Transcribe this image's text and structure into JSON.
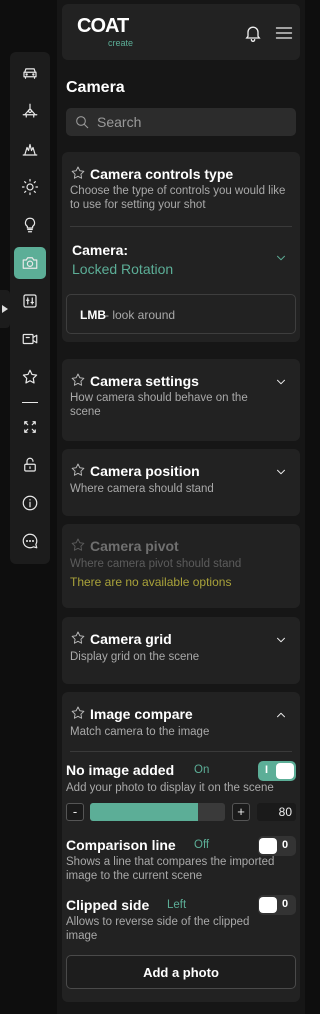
{
  "header": {
    "logo_main": "COAT",
    "logo_sub": "create"
  },
  "rail": {
    "items": [
      {
        "icon": "car-icon",
        "active": false
      },
      {
        "icon": "vehicle-3d-icon",
        "active": false
      },
      {
        "icon": "scene-icon",
        "active": false
      },
      {
        "icon": "sun-icon",
        "active": false
      },
      {
        "icon": "bulb-icon",
        "active": false
      },
      {
        "icon": "camera-icon",
        "active": true
      },
      {
        "icon": "adjustments-icon",
        "active": false
      },
      {
        "icon": "video-icon",
        "active": false
      },
      {
        "icon": "star-icon",
        "active": false
      },
      {
        "icon": "fullscreen-icon",
        "active": false
      },
      {
        "icon": "unlock-icon",
        "active": false
      },
      {
        "icon": "info-icon",
        "active": false
      },
      {
        "icon": "chat-icon",
        "active": false
      }
    ]
  },
  "panel": {
    "title": "Camera",
    "search_placeholder": "Search"
  },
  "controls_type": {
    "title": "Camera controls type",
    "desc": "Choose the type of controls you would like to use for setting your shot",
    "select_label": "Camera:",
    "select_value": "Locked Rotation",
    "hint_key": "LMB",
    "hint_text": " - look around"
  },
  "camera_settings": {
    "title": "Camera settings",
    "desc": "How camera should behave on the scene"
  },
  "camera_position": {
    "title": "Camera position",
    "desc": "Where camera should stand"
  },
  "camera_pivot": {
    "title": "Camera pivot",
    "desc": "Where camera pivot should stand",
    "note": "There are no available options"
  },
  "camera_grid": {
    "title": "Camera grid",
    "desc": "Display grid on the scene"
  },
  "image_compare": {
    "title": "Image compare",
    "desc": "Match camera to the image",
    "no_image": {
      "title": "No image added",
      "state": "On",
      "desc": "Add your photo to display it on the scene",
      "toggle_mark": "I"
    },
    "opacity": {
      "value": 80,
      "min": 0,
      "max": 100,
      "minus": "-",
      "plus": "+"
    },
    "comparison_line": {
      "title": "Comparison line",
      "state": "Off",
      "desc": "Shows a line that compares the imported image to the current scene",
      "toggle_mark": "0"
    },
    "clipped_side": {
      "title": "Clipped side",
      "state": "Left",
      "desc": "Allows to reverse side of the clipped image",
      "toggle_mark": "0"
    },
    "add_photo": "Add a photo"
  },
  "colors": {
    "accent": "#5cae97",
    "panel_bg": "#161616",
    "card_bg": "#222222",
    "note_yellow": "#a9a23a"
  }
}
